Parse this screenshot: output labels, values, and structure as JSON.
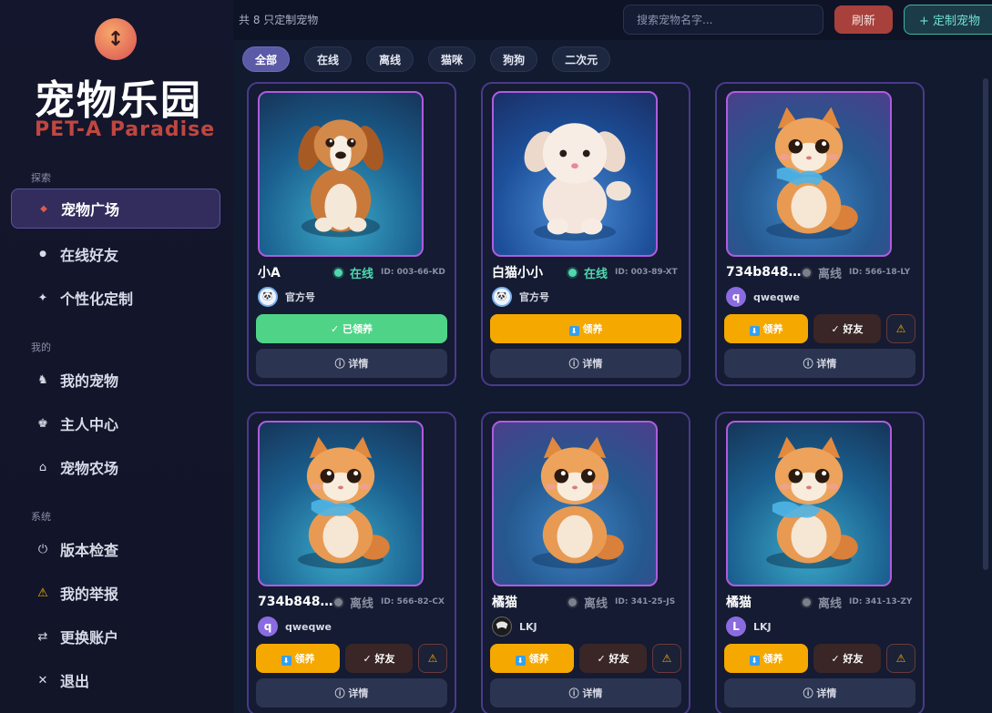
{
  "app": {
    "logo_symbol": "↕",
    "title": "宠物乐园",
    "subtitle": "PET-A  Paradise"
  },
  "sidebar": {
    "sections": [
      {
        "label": "探索",
        "items": [
          {
            "label": "宠物广场",
            "icon": "◆",
            "icon_name": "diamond-icon",
            "active": true
          },
          {
            "label": "在线好友",
            "icon": "●",
            "icon_name": "dot-icon"
          },
          {
            "label": "个性化定制",
            "icon": "✦",
            "icon_name": "sparkle-icon"
          }
        ]
      },
      {
        "label": "我的",
        "items": [
          {
            "label": "我的宠物",
            "icon": "♞",
            "icon_name": "pet-icon"
          },
          {
            "label": "主人中心",
            "icon": "♚",
            "icon_name": "owner-icon"
          },
          {
            "label": "宠物农场",
            "icon": "⌂",
            "icon_name": "farm-icon"
          }
        ]
      },
      {
        "label": "系统",
        "items": [
          {
            "label": "版本检查",
            "icon": "⏻",
            "icon_name": "power-icon"
          },
          {
            "label": "我的举报",
            "icon": "⚠",
            "icon_name": "warning-icon"
          },
          {
            "label": "更换账户",
            "icon": "⇄",
            "icon_name": "swap-icon"
          },
          {
            "label": "退出",
            "icon": "✕",
            "icon_name": "close-icon"
          }
        ]
      }
    ]
  },
  "topbar": {
    "count_text": "共 8 只定制宠物",
    "search_placeholder": "搜索宠物名字...",
    "refresh_label": "刷新",
    "custom_label": "+ 定制宠物"
  },
  "filters": [
    "全部",
    "在线",
    "离线",
    "猫咪",
    "狗狗",
    "二次元"
  ],
  "active_filter": "全部",
  "colors": {
    "accent": "#5b5aa6",
    "online": "#4fd8b0",
    "adopt": "#f5a800",
    "adopted": "#4fd487",
    "danger": "#a8403c"
  },
  "cards": [
    {
      "name": "小A",
      "status": "在线",
      "online": true,
      "id": "ID: 003-66-KD",
      "owner": "官方号",
      "owner_avatar": "🐼",
      "owner_type": "official",
      "pet": "dog",
      "adopted": true,
      "action_label": "✓ 已领养",
      "detail_label": "ⓘ 详情"
    },
    {
      "name": "白猫小小",
      "status": "在线",
      "online": true,
      "id": "ID: 003-89-XT",
      "owner": "官方号",
      "owner_avatar": "🐼",
      "owner_type": "official",
      "pet": "puppy",
      "adopt_label": "领养",
      "detail_label": "ⓘ 详情"
    },
    {
      "name": "734b8485...",
      "status": "离线",
      "online": false,
      "id": "ID: 566-18-LY",
      "owner": "qweqwe",
      "owner_avatar": "q",
      "owner_type": "purple",
      "pet": "cat",
      "adopt_label": "领养",
      "friend_label": "✓ 好友",
      "report_icon": "⚠",
      "detail_label": "ⓘ 详情"
    },
    {
      "name": "734b8485..",
      "status": "离线",
      "online": false,
      "id": "ID: 566-82-CX",
      "owner": "qweqwe",
      "owner_avatar": "q",
      "owner_type": "purple",
      "pet": "cat",
      "adopt_label": "领养",
      "friend_label": "✓ 好友",
      "report_icon": "⚠",
      "detail_label": "ⓘ 详情"
    },
    {
      "name": "橘猫",
      "status": "离线",
      "online": false,
      "id": "ID: 341-25-JS",
      "owner": "LKJ",
      "owner_avatar": "",
      "owner_type": "dark",
      "pet": "cat",
      "adopt_label": "领养",
      "friend_label": "✓ 好友",
      "report_icon": "⚠",
      "detail_label": "ⓘ 详情"
    },
    {
      "name": "橘猫",
      "status": "离线",
      "online": false,
      "id": "ID: 341-13-ZY",
      "owner": "LKJ",
      "owner_avatar": "L",
      "owner_type": "purple",
      "pet": "cat",
      "adopt_label": "领养",
      "friend_label": "✓ 好友",
      "report_icon": "⚠",
      "detail_label": "ⓘ 详情"
    }
  ]
}
